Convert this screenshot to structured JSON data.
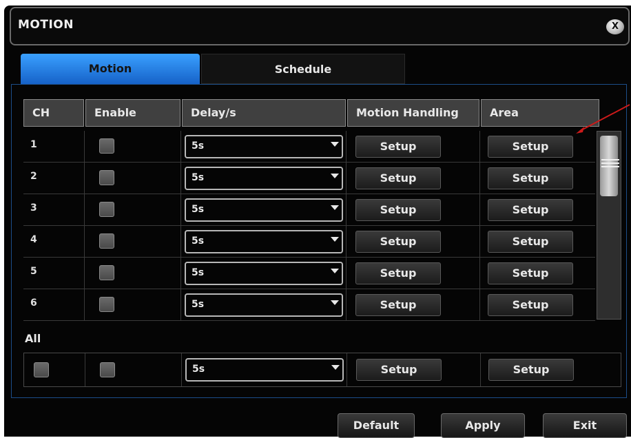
{
  "window": {
    "title": "MOTION",
    "close_label": "X"
  },
  "tabs": [
    {
      "label": "Motion",
      "active": true
    },
    {
      "label": "Schedule",
      "active": false
    }
  ],
  "table": {
    "headers": [
      "CH",
      "Enable",
      "Delay/s",
      "Motion  Handling",
      "Area"
    ],
    "rows": [
      {
        "ch": "1",
        "enabled": false,
        "delay": "5s",
        "handling_btn": "Setup",
        "area_btn": "Setup"
      },
      {
        "ch": "2",
        "enabled": false,
        "delay": "5s",
        "handling_btn": "Setup",
        "area_btn": "Setup"
      },
      {
        "ch": "3",
        "enabled": false,
        "delay": "5s",
        "handling_btn": "Setup",
        "area_btn": "Setup"
      },
      {
        "ch": "4",
        "enabled": false,
        "delay": "5s",
        "handling_btn": "Setup",
        "area_btn": "Setup"
      },
      {
        "ch": "5",
        "enabled": false,
        "delay": "5s",
        "handling_btn": "Setup",
        "area_btn": "Setup"
      },
      {
        "ch": "6",
        "enabled": false,
        "delay": "5s",
        "handling_btn": "Setup",
        "area_btn": "Setup"
      }
    ]
  },
  "all": {
    "label": "All",
    "select_all": false,
    "enabled": false,
    "delay": "5s",
    "handling_btn": "Setup",
    "area_btn": "Setup"
  },
  "footer": {
    "default_label": "Default",
    "apply_label": "Apply",
    "exit_label": "Exit"
  },
  "colors": {
    "accent": "#2a86f0",
    "annotation_arrow": "#cc1a1a",
    "background": "#050505"
  }
}
